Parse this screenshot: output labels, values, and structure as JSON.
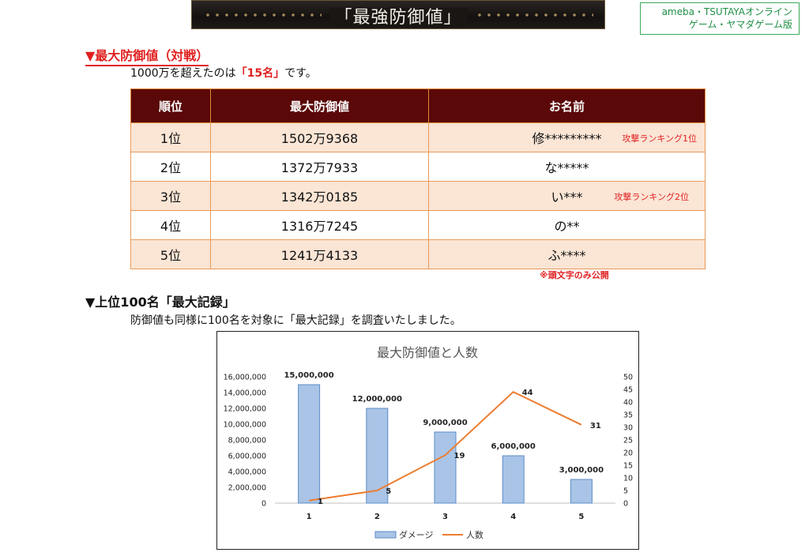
{
  "banner": {
    "title": "「最強防御値」"
  },
  "source_box": {
    "line1": "ameba・TSUTAYAオンライン",
    "line2": "ゲーム・ヤマダゲーム版"
  },
  "section1": {
    "heading": "▼最大防御値（対戦）",
    "text_before": "1000万を超えたのは",
    "highlight": "「15名」",
    "text_after": "です。"
  },
  "table": {
    "headers": [
      "順位",
      "最大防御値",
      "お名前"
    ],
    "rows": [
      {
        "rank": "1位",
        "value": "1502万9368",
        "name": "修*********",
        "note": "攻撃ランキング1位"
      },
      {
        "rank": "2位",
        "value": "1372万7933",
        "name": "な*****",
        "note": ""
      },
      {
        "rank": "3位",
        "value": "1342万0185",
        "name": "い***",
        "note": "攻撃ランキング2位"
      },
      {
        "rank": "4位",
        "value": "1316万7245",
        "name": "の**",
        "note": ""
      },
      {
        "rank": "5位",
        "value": "1241万4133",
        "name": "ふ****",
        "note": ""
      }
    ],
    "disclaimer": "※頭文字のみ公開"
  },
  "section2": {
    "heading": "▼上位100名「最大記録」",
    "text": "防御値も同様に100名を対象に「最大記録」を調査いたしました。"
  },
  "chart_data": {
    "type": "bar",
    "title": "最大防御値と人数",
    "categories": [
      "1",
      "2",
      "3",
      "4",
      "5"
    ],
    "series": [
      {
        "name": "ダメージ",
        "type": "bar",
        "axis": "left",
        "values": [
          15000000,
          12000000,
          9000000,
          6000000,
          3000000
        ],
        "labels": [
          "15,000,000",
          "12,000,000",
          "9,000,000",
          "6,000,000",
          "3,000,000"
        ]
      },
      {
        "name": "人数",
        "type": "line",
        "axis": "right",
        "values": [
          1,
          5,
          19,
          44,
          31
        ]
      }
    ],
    "ylim_left": [
      0,
      16000000
    ],
    "ylim_right": [
      0,
      50
    ],
    "left_ticks": [
      "0",
      "2,000,000",
      "4,000,000",
      "6,000,000",
      "8,000,000",
      "10,000,000",
      "12,000,000",
      "14,000,000",
      "16,000,000"
    ],
    "right_ticks": [
      "0",
      "5",
      "10",
      "15",
      "20",
      "25",
      "30",
      "35",
      "40",
      "45",
      "50"
    ],
    "legend_position": "bottom",
    "grid": false,
    "colors": {
      "bar_fill": "#a9c4e6",
      "bar_stroke": "#5b8cc8",
      "line": "#ed7d31"
    }
  }
}
